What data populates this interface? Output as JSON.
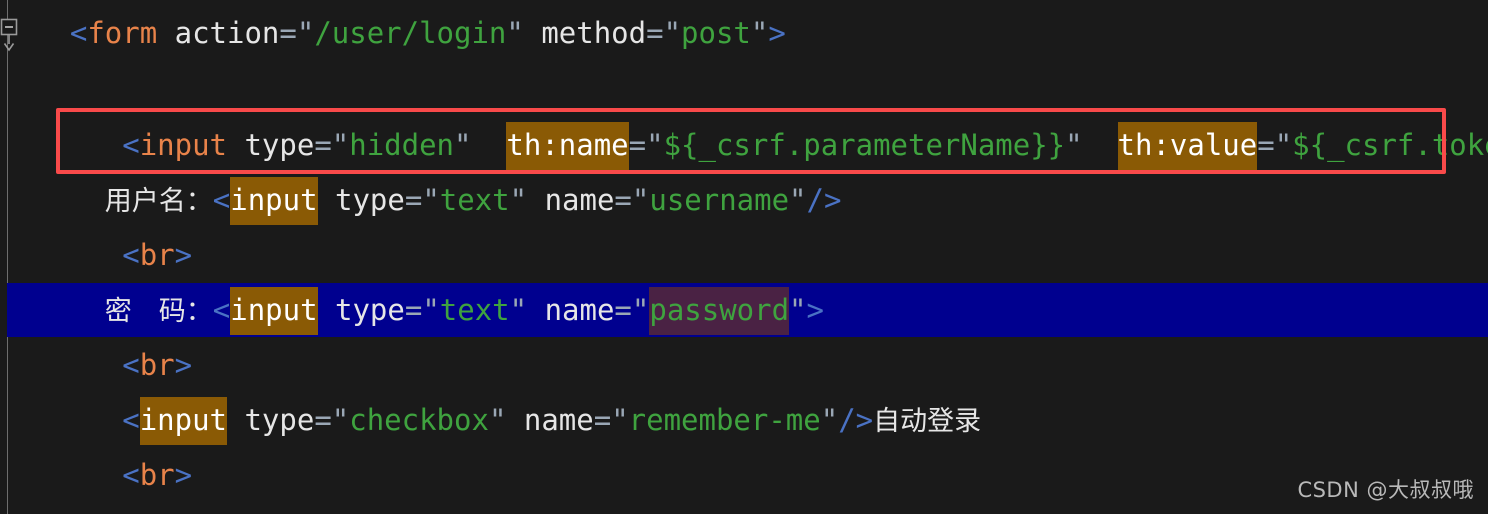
{
  "editor": {
    "background_color": "#1a1a1a",
    "selection_color": "#00008f",
    "match_highlight_color": "#8a5a05",
    "alt_highlight_color": "#4a2244",
    "annotation_border_color": "#f94a4a",
    "indent_guide_color": "#6e6e6e"
  },
  "fold_marker": {
    "name": "code-fold-collapse-marker",
    "state": "expanded"
  },
  "code": {
    "lines": [
      {
        "id": "line-form-open",
        "indent": "",
        "selected": false,
        "tokens": [
          {
            "t": "bracket",
            "v": "<"
          },
          {
            "t": "tag",
            "v": "form"
          },
          {
            "t": "plain",
            "v": " "
          },
          {
            "t": "attr",
            "v": "action"
          },
          {
            "t": "eq",
            "v": "="
          },
          {
            "t": "quote",
            "v": "\""
          },
          {
            "t": "str",
            "v": "/user/login"
          },
          {
            "t": "quote",
            "v": "\""
          },
          {
            "t": "plain",
            "v": " "
          },
          {
            "t": "attr",
            "v": "method"
          },
          {
            "t": "eq",
            "v": "="
          },
          {
            "t": "quote",
            "v": "\""
          },
          {
            "t": "str",
            "v": "post"
          },
          {
            "t": "quote",
            "v": "\""
          },
          {
            "t": "bracket",
            "v": ">"
          }
        ]
      },
      {
        "id": "line-csrf-hidden-input",
        "indent": "   ",
        "selected": false,
        "tokens": [
          {
            "t": "bracket",
            "v": "<"
          },
          {
            "t": "tag",
            "v": "input"
          },
          {
            "t": "plain",
            "v": " "
          },
          {
            "t": "attr",
            "v": "type"
          },
          {
            "t": "eq",
            "v": "="
          },
          {
            "t": "quote",
            "v": "\""
          },
          {
            "t": "str",
            "v": "hidden"
          },
          {
            "t": "quote",
            "v": "\""
          },
          {
            "t": "plain",
            "v": "  "
          },
          {
            "t": "match",
            "v": "th:name"
          },
          {
            "t": "eq",
            "v": "="
          },
          {
            "t": "quote",
            "v": "\""
          },
          {
            "t": "str",
            "v": "${_csrf.parameterName}}"
          },
          {
            "t": "quote",
            "v": "\""
          },
          {
            "t": "plain",
            "v": "  "
          },
          {
            "t": "match-underlined",
            "v": "th:value"
          },
          {
            "t": "eq",
            "v": "="
          },
          {
            "t": "quote",
            "v": "\""
          },
          {
            "t": "str",
            "v": "${_csrf.token}}"
          },
          {
            "t": "quote",
            "v": "\""
          },
          {
            "t": "bracket",
            "v": "/>"
          }
        ]
      },
      {
        "id": "line-username-input",
        "indent": "  ",
        "selected": false,
        "tokens": [
          {
            "t": "cjk",
            "v": "用户名："
          },
          {
            "t": "bracket",
            "v": "<"
          },
          {
            "t": "match",
            "v": "input"
          },
          {
            "t": "plain",
            "v": " "
          },
          {
            "t": "attr",
            "v": "type"
          },
          {
            "t": "eq",
            "v": "="
          },
          {
            "t": "quote",
            "v": "\""
          },
          {
            "t": "str",
            "v": "text"
          },
          {
            "t": "quote",
            "v": "\""
          },
          {
            "t": "plain",
            "v": " "
          },
          {
            "t": "attr",
            "v": "name"
          },
          {
            "t": "eq",
            "v": "="
          },
          {
            "t": "quote",
            "v": "\""
          },
          {
            "t": "str",
            "v": "username"
          },
          {
            "t": "quote",
            "v": "\""
          },
          {
            "t": "bracket",
            "v": "/>"
          }
        ]
      },
      {
        "id": "line-br-1",
        "indent": "   ",
        "selected": false,
        "tokens": [
          {
            "t": "bracket",
            "v": "<"
          },
          {
            "t": "tag",
            "v": "br"
          },
          {
            "t": "bracket",
            "v": ">"
          }
        ]
      },
      {
        "id": "line-password-input",
        "indent": "  ",
        "selected": true,
        "tokens": [
          {
            "t": "cjk",
            "v": "密　码："
          },
          {
            "t": "bracket",
            "v": "<"
          },
          {
            "t": "match",
            "v": "input"
          },
          {
            "t": "plain",
            "v": " "
          },
          {
            "t": "attr",
            "v": "type"
          },
          {
            "t": "eq",
            "v": "="
          },
          {
            "t": "quote",
            "v": "\""
          },
          {
            "t": "str",
            "v": "text"
          },
          {
            "t": "quote",
            "v": "\""
          },
          {
            "t": "plain",
            "v": " "
          },
          {
            "t": "attr",
            "v": "name"
          },
          {
            "t": "eq",
            "v": "="
          },
          {
            "t": "quote",
            "v": "\""
          },
          {
            "t": "alt-str",
            "v": "password"
          },
          {
            "t": "quote",
            "v": "\""
          },
          {
            "t": "bracket",
            "v": ">"
          }
        ]
      },
      {
        "id": "line-br-2",
        "indent": "   ",
        "selected": false,
        "tokens": [
          {
            "t": "bracket",
            "v": "<"
          },
          {
            "t": "tag",
            "v": "br"
          },
          {
            "t": "bracket",
            "v": ">"
          }
        ]
      },
      {
        "id": "line-remember-me-checkbox",
        "indent": "   ",
        "selected": false,
        "tokens": [
          {
            "t": "bracket",
            "v": "<"
          },
          {
            "t": "match",
            "v": "input"
          },
          {
            "t": "plain",
            "v": " "
          },
          {
            "t": "attr",
            "v": "type"
          },
          {
            "t": "eq",
            "v": "="
          },
          {
            "t": "quote",
            "v": "\""
          },
          {
            "t": "str",
            "v": "checkbox"
          },
          {
            "t": "quote",
            "v": "\""
          },
          {
            "t": "plain",
            "v": " "
          },
          {
            "t": "attr",
            "v": "name"
          },
          {
            "t": "eq",
            "v": "="
          },
          {
            "t": "quote",
            "v": "\""
          },
          {
            "t": "str",
            "v": "remember-me"
          },
          {
            "t": "quote",
            "v": "\""
          },
          {
            "t": "bracket",
            "v": "/>"
          },
          {
            "t": "cjk",
            "v": "自动登录"
          }
        ]
      },
      {
        "id": "line-br-3",
        "indent": "   ",
        "selected": false,
        "tokens": [
          {
            "t": "bracket",
            "v": "<"
          },
          {
            "t": "tag",
            "v": "br"
          },
          {
            "t": "bracket",
            "v": ">"
          }
        ]
      }
    ]
  },
  "watermark": {
    "text": "CSDN @大叔叔哦"
  }
}
